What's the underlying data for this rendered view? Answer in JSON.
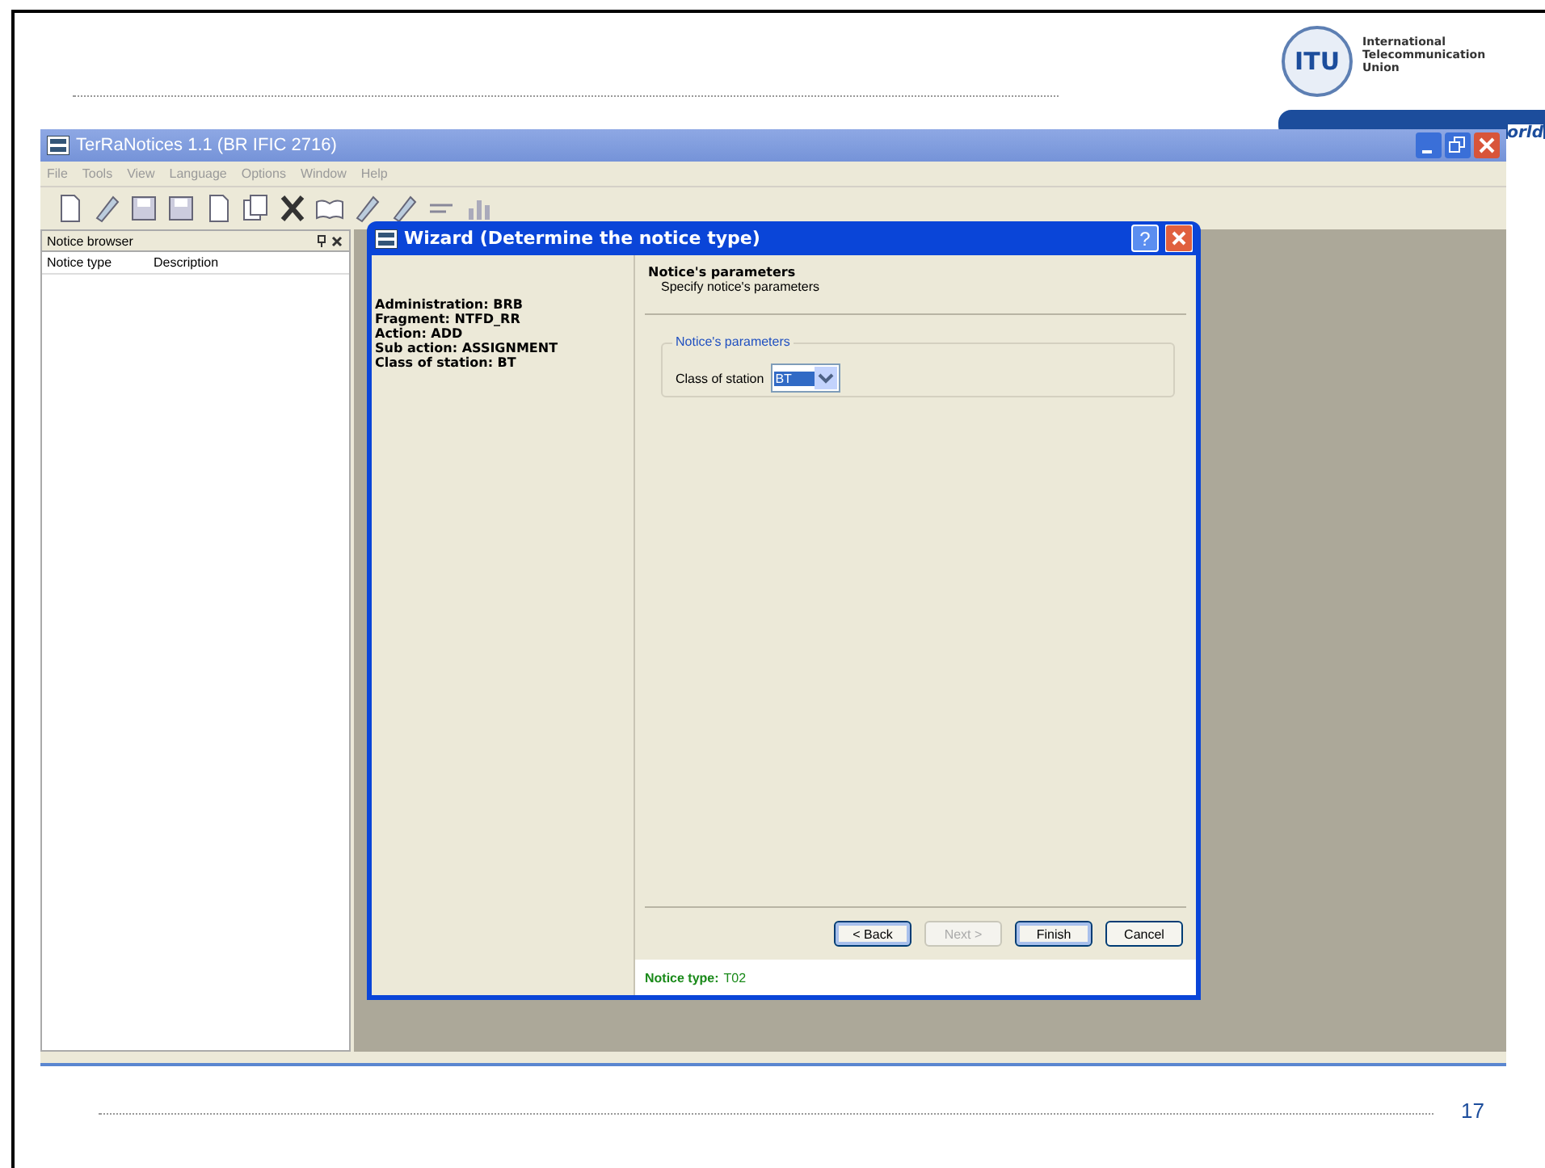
{
  "slide": {
    "logo": {
      "mark": "ITU",
      "name_lines": [
        "International",
        "Telecommunication",
        "Union"
      ],
      "slogan": "orld"
    },
    "page_number": "17"
  },
  "app": {
    "title": "TerRaNotices 1.1 (BR IFIC 2716)",
    "menu": [
      "File",
      "Tools",
      "View",
      "Language",
      "Options",
      "Window",
      "Help"
    ],
    "notice_browser": {
      "title": "Notice browser",
      "columns": [
        "Notice type",
        "Description"
      ]
    }
  },
  "wizard": {
    "title": "Wizard (Determine the notice type)",
    "help_button": "?",
    "summary": [
      "Administration: BRB",
      "Fragment: NTFD_RR",
      "Action: ADD",
      "Sub action: ASSIGNMENT",
      "Class of station: BT"
    ],
    "header": {
      "title": "Notice's parameters",
      "subtitle": "Specify notice's parameters"
    },
    "group": {
      "legend": "Notice's parameters",
      "fields": [
        {
          "label": "Class of station",
          "value": "BT"
        }
      ]
    },
    "buttons": [
      {
        "label": "< Back",
        "disabled": false,
        "highlighted": true
      },
      {
        "label": "Next >",
        "disabled": true,
        "highlighted": false
      },
      {
        "label": "Finish",
        "disabled": false,
        "highlighted": true
      },
      {
        "label": "Cancel",
        "disabled": false,
        "highlighted": false
      }
    ],
    "status": {
      "label": "Notice type:",
      "value": "T02"
    }
  }
}
